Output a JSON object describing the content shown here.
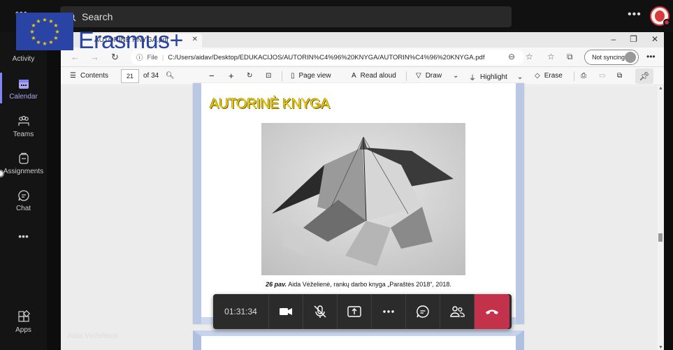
{
  "teams": {
    "search_placeholder": "Search",
    "top_more": "•••",
    "rail": [
      {
        "label": "Activity",
        "icon": "bell-icon"
      },
      {
        "label": "Calendar",
        "icon": "calendar-icon",
        "active": true
      },
      {
        "label": "Teams",
        "icon": "teams-icon"
      },
      {
        "label": "Assignments",
        "icon": "assignments-icon"
      },
      {
        "label": "Chat",
        "icon": "chat-icon"
      },
      {
        "label": "•••",
        "icon": "more-icon"
      },
      {
        "label": "Apps",
        "icon": "apps-icon"
      }
    ],
    "accent": "#7f85f5",
    "speaker_name": "Aida Vėželienė"
  },
  "logo": {
    "text": "Erasmus+",
    "color": "#2a44a6"
  },
  "browser": {
    "tab_title": "AUTORINĖ KNYGA.pdf",
    "address": {
      "scheme_label": "File",
      "url": "C:/Users/aidav/Desktop/EDUKACIJOS/AUTORIN%C4%96%20KNYGA/AUTORIN%C4%96%20KNYGA.pdf"
    },
    "sync_label": "Not syncing"
  },
  "pdf_toolbar": {
    "contents": "Contents",
    "page": "21",
    "of_pages": "of 34",
    "page_view": "Page view",
    "read_aloud": "Read aloud",
    "draw": "Draw",
    "highlight": "Highlight",
    "erase": "Erase"
  },
  "document": {
    "title": "AUTORINĖ KNYGA",
    "title_color": "#f4d000",
    "caption_bold": "26 pav.",
    "caption_text": " Aida Vėželienė, rankų darbo knyga „Paraštės 2018“, 2018."
  },
  "meeting": {
    "timer": "01:31:34",
    "hangup_color": "#c4314b"
  }
}
